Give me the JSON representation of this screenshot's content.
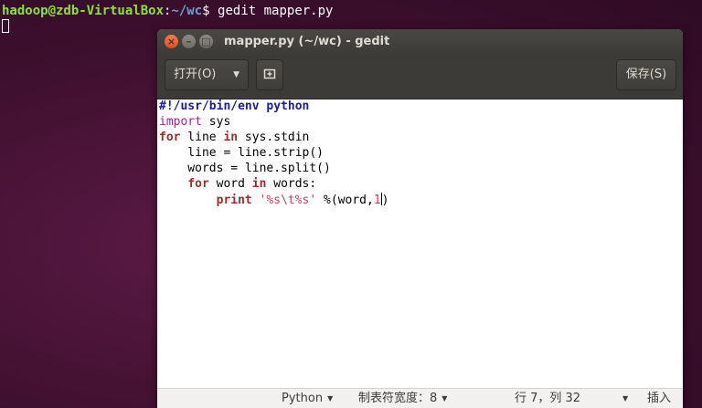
{
  "terminal": {
    "user_host": "hadoop@zdb-VirtualBox",
    "sep": ":",
    "path": "~/wc",
    "prompt": "$ ",
    "command": "gedit mapper.py"
  },
  "window": {
    "title": "mapper.py (~/wc) - gedit",
    "close_symbol": "×",
    "min_symbol": "–",
    "max_symbol": "□"
  },
  "toolbar": {
    "open_label": "打开(O)",
    "save_label": "保存(S)",
    "new_tab_icon": "new-tab-icon"
  },
  "code": {
    "line1": "#!/usr/bin/env python",
    "line2_kw": "import",
    "line2_rest": " sys",
    "line3_kw1": "for",
    "line3_mid": " line ",
    "line3_kw2": "in",
    "line3_rest": " sys.stdin",
    "line4": "    line = line.strip()",
    "line5": "    words = line.split()",
    "line6_indent": "    ",
    "line6_kw1": "for",
    "line6_mid": " word ",
    "line6_kw2": "in",
    "line6_rest": " words:",
    "line7_indent": "        ",
    "line7_kw": "print",
    "line7_sp": " ",
    "line7_str": "'%s\\t%s'",
    "line7_mid": " %(word,",
    "line7_num": "1",
    "line7_end": ")"
  },
  "status": {
    "language": "Python",
    "tab_width": "制表符宽度：8",
    "position": "行 7，列 32",
    "mode": "插入"
  }
}
